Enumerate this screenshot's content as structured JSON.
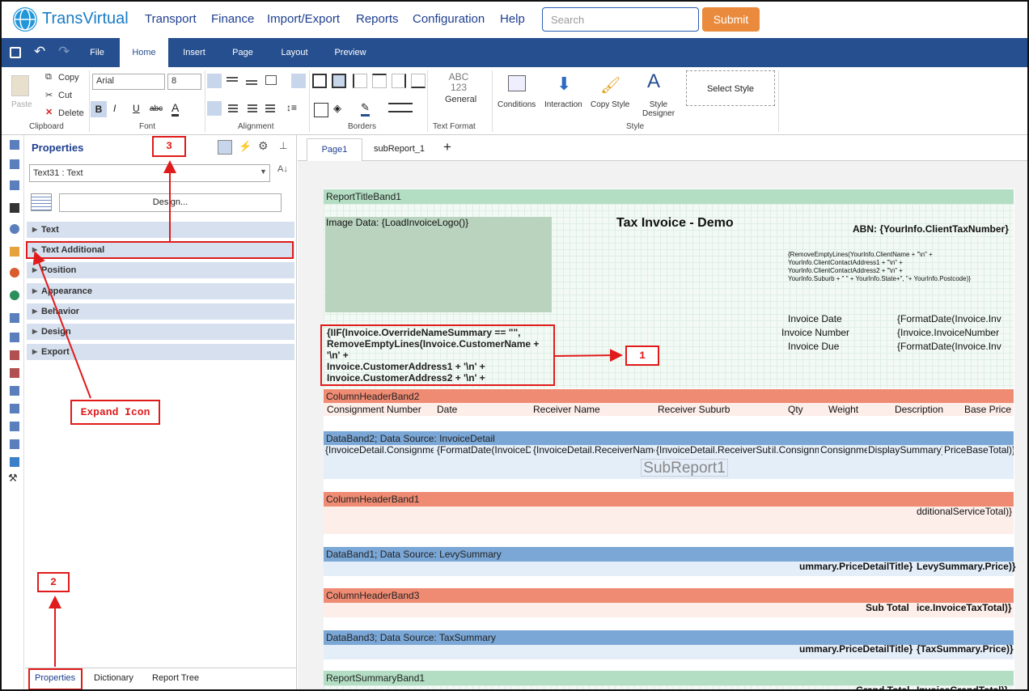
{
  "app": {
    "logo": "TransVirtual",
    "nav": [
      "Transport",
      "Finance",
      "Import/Export",
      "Reports",
      "Configuration",
      "Help"
    ],
    "search_placeholder": "Search",
    "submit": "Submit"
  },
  "ribbon_tabs": [
    "File",
    "Home",
    "Insert",
    "Page",
    "Layout",
    "Preview"
  ],
  "ribbon": {
    "clipboard": {
      "paste": "Paste",
      "copy": "Copy",
      "cut": "Cut",
      "delete": "Delete",
      "label": "Clipboard"
    },
    "font": {
      "family": "Arial",
      "size": "8",
      "label": "Font",
      "underline_a": "A"
    },
    "alignment_label": "Alignment",
    "borders_label": "Borders",
    "text_format": {
      "icon": "ABC\n123",
      "general": "General",
      "label": "Text Format"
    },
    "style": {
      "conditions": "Conditions",
      "interaction": "Interaction",
      "copy_style": "Copy Style",
      "style_designer": "Style Designer",
      "select_style": "Select Style",
      "label": "Style"
    }
  },
  "properties": {
    "title": "Properties",
    "selector": "Text31 : Text",
    "design_btn": "Design...",
    "categories": [
      "Text",
      "Text Additional",
      "Position",
      "Appearance",
      "Behavior",
      "Design",
      "Export"
    ],
    "bottom_tabs": [
      "Properties",
      "Dictionary",
      "Report Tree"
    ]
  },
  "page_tabs": [
    "Page1",
    "subReport_1",
    "+"
  ],
  "report": {
    "title_band": "ReportTitleBand1",
    "image_data": "Image Data: {LoadInvoiceLogo()}",
    "tax_invoice": "Tax Invoice - Demo",
    "abn": "ABN: {YourInfo.ClientTaxNumber}",
    "address_expr": [
      "{RemoveEmptyLines(YourInfo.ClientName + \"\\n\" +",
      "YourInfo.ClientContactAddress1 + \"\\n\" +",
      "YourInfo.ClientContactAddress2 + \"\\n\" +",
      "YourInfo.Suburb + \" \" + YourInfo.State+\", \"+ YourInfo.Postcode)}"
    ],
    "invoice_labels": [
      "Invoice Date",
      "Invoice Number",
      "Invoice Due"
    ],
    "invoice_values": [
      "{FormatDate(Invoice.Inv",
      "{Invoice.InvoiceNumber",
      "{FormatDate(Invoice.Inv"
    ],
    "customer_expr": [
      "{IIF(Invoice.OverrideNameSummary == \"\",",
      "RemoveEmptyLines(Invoice.CustomerName +",
      "'\\n' +",
      "Invoice.CustomerAddress1 + '\\n' +",
      "Invoice.CustomerAddress2 + '\\n' +"
    ],
    "column_header_band2": "ColumnHeaderBand2",
    "headers": [
      "Consignment Number",
      "Date",
      "Receiver Name",
      "Receiver Suburb",
      "Qty",
      "Weight",
      "Description",
      "Base Price"
    ],
    "data_band2": "DataBand2; Data Source: InvoiceDetail",
    "data_cells": [
      "{InvoiceDetail.Consignme",
      "{FormatDate(InvoiceD",
      "{InvoiceDetail.ReceiverName",
      "{InvoiceDetail.ReceiverSub",
      "il.Consignm",
      "Consignme",
      "DisplaySummary}",
      "PriceBaseTotal)}"
    ],
    "subreport": "SubReport1",
    "column_header_band1": "ColumnHeaderBand1",
    "additional_total": "dditionalServiceTotal)}",
    "data_band1": "DataBand1; Data Source: LevySummary",
    "levy_cells": [
      "ummary.PriceDetailTitle}",
      "LevySummary.Price)}"
    ],
    "column_header_band3": "ColumnHeaderBand3",
    "subtotal_cells": [
      "Sub Total",
      "ice.InvoiceTaxTotal)}"
    ],
    "data_band3": "DataBand3; Data Source: TaxSummary",
    "tax_cells": [
      "ummary.PriceDetailTitle}",
      "{TaxSummary.Price)}"
    ],
    "summary_band": "ReportSummaryBand1",
    "grand_cells": [
      "Grand Total",
      "InvoiceGrandTotal)}"
    ]
  },
  "annotations": {
    "n1": "1",
    "n2": "2",
    "n3": "3",
    "expand": "Expand Icon"
  },
  "colors": {
    "accent": "#e01b1b",
    "nav": "#264f8f",
    "submit": "#e98a3d"
  }
}
